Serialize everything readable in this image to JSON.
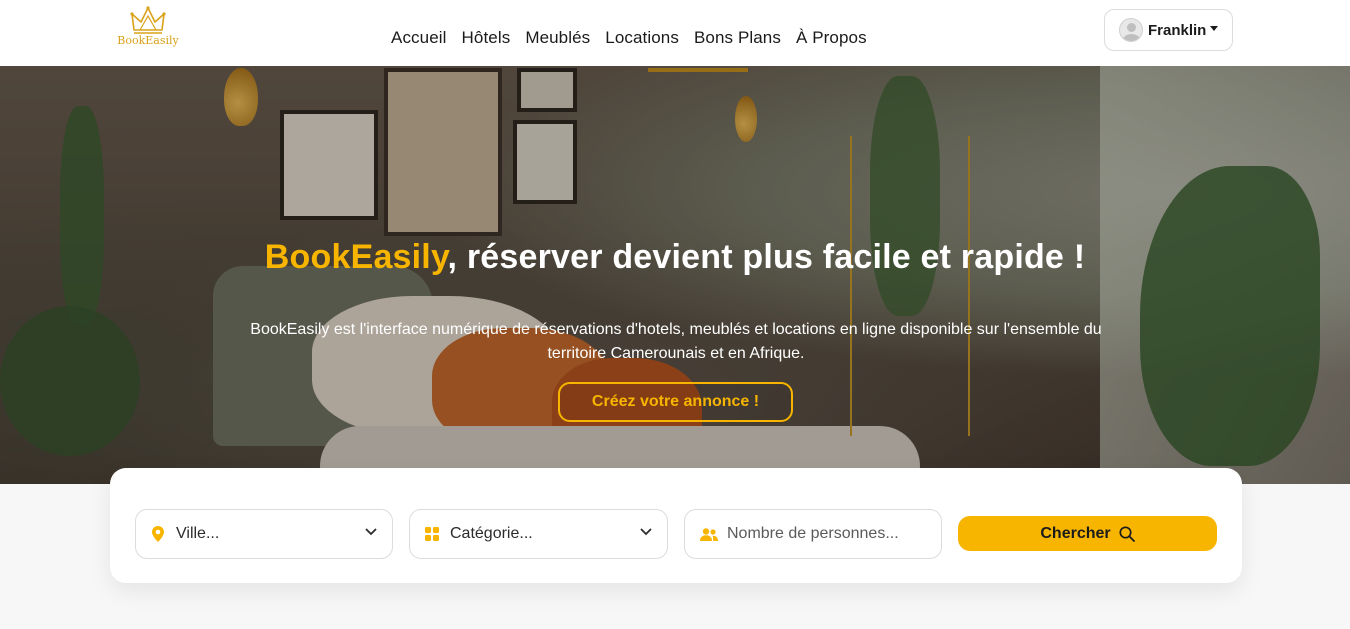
{
  "header": {
    "logo_text": "BookEasily",
    "nav": [
      "Accueil",
      "Hôtels",
      "Meublés",
      "Locations",
      "Bons Plans",
      "À Propos"
    ],
    "user_name": "Franklin"
  },
  "hero": {
    "title_brand": "BookEasily",
    "title_rest": ", réserver devient plus facile et rapide !",
    "description": "BookEasily est l'interface numérique de réservations d'hotels, meublés et locations en ligne disponible sur l'ensemble du territoire Camerounais et en Afrique.",
    "cta_label": "Créez votre annonce !"
  },
  "search": {
    "city_value": "Ville...",
    "category_value": "Catégorie...",
    "persons_placeholder": "Nombre de personnes...",
    "button_label": "Chercher"
  },
  "colors": {
    "accent": "#f7b500",
    "text_dark": "#1b1b1b"
  },
  "icons": [
    "crown-logo-icon",
    "user-avatar-icon",
    "caret-down-icon",
    "map-pin-icon",
    "grid-icon",
    "users-icon",
    "chevron-down-icon",
    "search-icon"
  ]
}
